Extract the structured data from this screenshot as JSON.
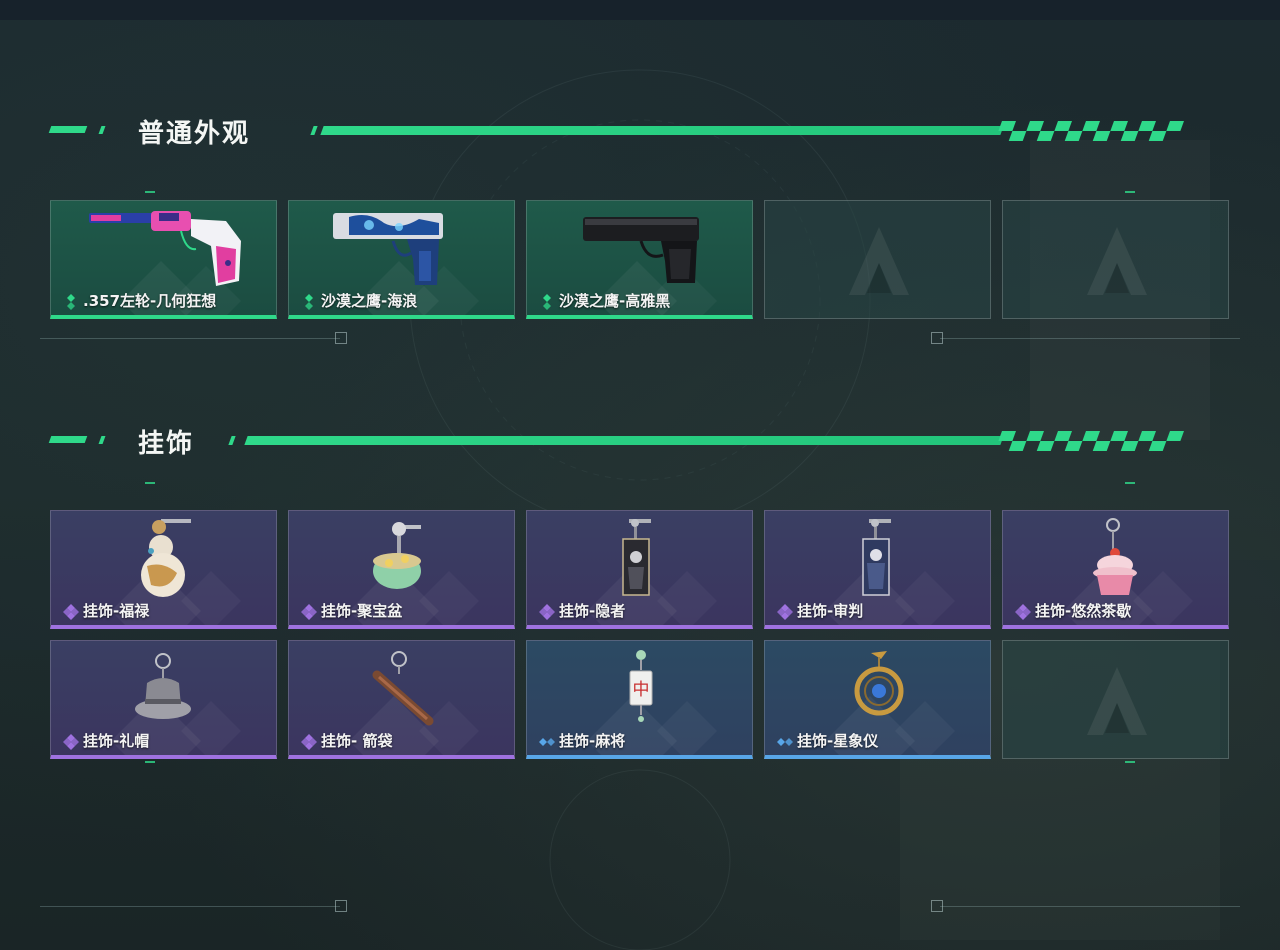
{
  "sections": [
    {
      "title": "普通外观",
      "items": [
        {
          "label": ".357左轮-几何狂想",
          "rarity": "green",
          "icon": "revolver-geometric-icon"
        },
        {
          "label": "沙漠之鹰-海浪",
          "rarity": "green",
          "icon": "desert-eagle-wave-icon"
        },
        {
          "label": "沙漠之鹰-高雅黑",
          "rarity": "green",
          "icon": "desert-eagle-black-icon"
        },
        {
          "label": "",
          "rarity": "empty",
          "icon": "empty-slot-logo-icon"
        },
        {
          "label": "",
          "rarity": "empty",
          "icon": "empty-slot-logo-icon"
        }
      ]
    },
    {
      "title": "挂饰",
      "items": [
        {
          "label": "挂饰-福禄",
          "rarity": "purple",
          "icon": "gourd-charm-icon"
        },
        {
          "label": "挂饰-聚宝盆",
          "rarity": "purple",
          "icon": "treasure-bowl-charm-icon"
        },
        {
          "label": "挂饰-隐者",
          "rarity": "purple",
          "icon": "hermit-card-charm-icon"
        },
        {
          "label": "挂饰-审判",
          "rarity": "purple",
          "icon": "judgement-card-charm-icon"
        },
        {
          "label": "挂饰-悠然茶歇",
          "rarity": "purple",
          "icon": "cupcake-charm-icon"
        },
        {
          "label": "挂饰-礼帽",
          "rarity": "purple",
          "icon": "hat-charm-icon"
        },
        {
          "label": "挂饰- 箭袋",
          "rarity": "purple",
          "icon": "quiver-charm-icon"
        },
        {
          "label": "挂饰-麻将",
          "rarity": "blue",
          "icon": "mahjong-tile-charm-icon"
        },
        {
          "label": "挂饰-星象仪",
          "rarity": "blue",
          "icon": "astrolabe-charm-icon"
        },
        {
          "label": "",
          "rarity": "empty",
          "icon": "empty-slot-logo-icon"
        }
      ]
    }
  ],
  "mahjong_glyph": "中",
  "colors": {
    "green": "#2fd98a",
    "purple": "#9f72e0",
    "blue": "#58a6e8",
    "title": "#f4f6f4"
  }
}
